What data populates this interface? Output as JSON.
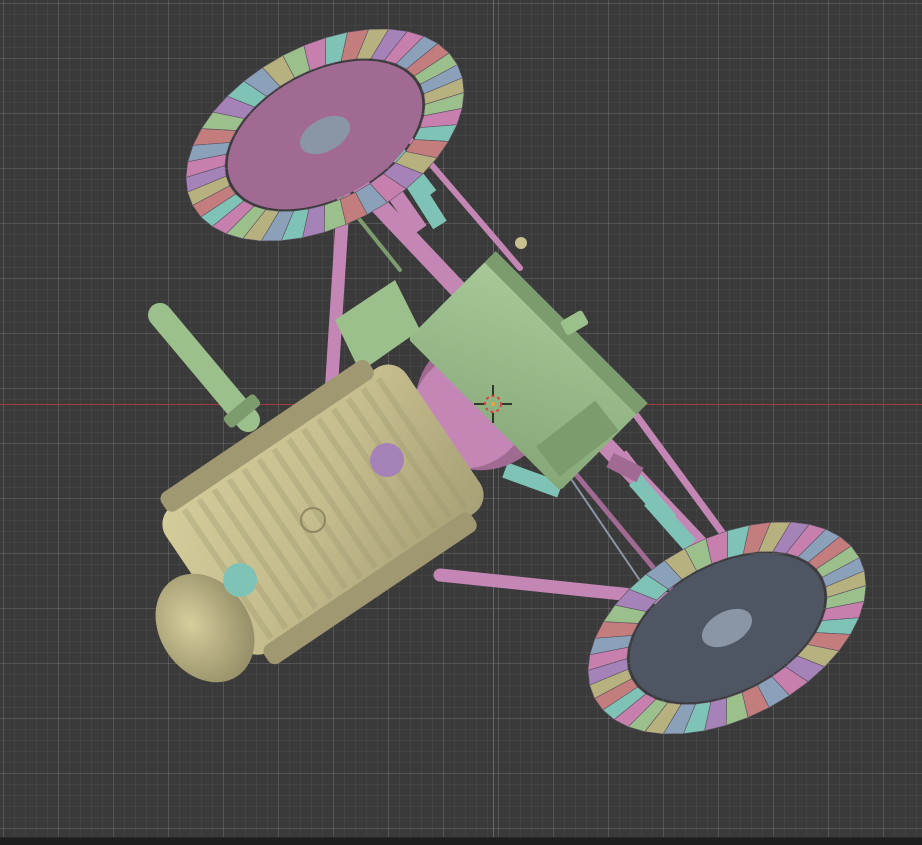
{
  "viewport": {
    "background": "#3a3a3a",
    "x_axis_color": "#a23c3c",
    "y_axis_color": "#3f6f9e",
    "grid": true
  },
  "colors": {
    "pink": "#c486b4",
    "pink_dark": "#a06a93",
    "green": "#9cc08c",
    "green_dark": "#7c9c6e",
    "olive": "#c8c091",
    "olive_dark": "#9f9870",
    "teal": "#7fc3b6",
    "tire_blue": "#8aa1b9",
    "tire_purple": "#a582b8",
    "tire_red": "#c37d7d",
    "tire_pink": "#c77fae",
    "tire_olive": "#b6b17e",
    "hub_gray": "#8a96a5",
    "cursor_red": "#e04040"
  },
  "objects": {
    "cursor_icon": "3d-cursor-icon",
    "wheel_icon": "wheel-icon",
    "engine_icon": "engine-icon",
    "fuel_tank_icon": "fuel-tank-icon"
  }
}
